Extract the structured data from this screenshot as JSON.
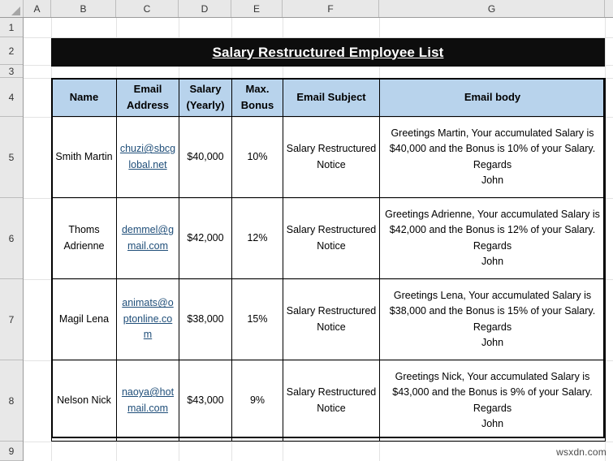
{
  "app": {
    "type": "spreadsheet",
    "watermark": "wsxdn.com"
  },
  "column_headers": [
    "A",
    "B",
    "C",
    "D",
    "E",
    "F",
    "G"
  ],
  "row_headers": [
    "1",
    "2",
    "3",
    "4",
    "5",
    "6",
    "7",
    "8",
    "9"
  ],
  "title": {
    "text": "Salary Restructured Employee List",
    "background": "#0d0d0d",
    "color": "#ffffff"
  },
  "table": {
    "header_background": "#b8d3ec",
    "link_color": "#1f4e79",
    "headers": [
      "Name",
      "Email Address",
      "Salary (Yearly)",
      "Max. Bonus",
      "Email Subject",
      "Email body"
    ],
    "rows": [
      {
        "name": "Smith Martin",
        "email": "chuzi@sbcglobal.net",
        "salary": "$40,000",
        "bonus": "10%",
        "subject": "Salary Restructured Notice",
        "body": "Greetings Martin, Your accumulated Salary is $40,000 and the Bonus is 10% of your Salary.\nRegards\nJohn"
      },
      {
        "name": "Thoms Adrienne",
        "email": "demmel@gmail.com",
        "salary": "$42,000",
        "bonus": "12%",
        "subject": "Salary Restructured Notice",
        "body": "Greetings Adrienne, Your accumulated Salary is $42,000 and the Bonus is 12% of your Salary.\nRegards\nJohn"
      },
      {
        "name": "Magil Lena",
        "email": "animats@optonline.com",
        "salary": "$38,000",
        "bonus": "15%",
        "subject": "Salary Restructured Notice",
        "body": "Greetings Lena, Your accumulated Salary is $38,000 and the Bonus is 15% of your Salary.\nRegards\nJohn"
      },
      {
        "name": "Nelson Nick",
        "email": "naoya@hotmail.com",
        "salary": "$43,000",
        "bonus": "9%",
        "subject": "Salary Restructured Notice",
        "body": "Greetings Nick, Your accumulated Salary is $43,000 and the Bonus is 9% of your Salary.\nRegards\nJohn"
      }
    ]
  }
}
